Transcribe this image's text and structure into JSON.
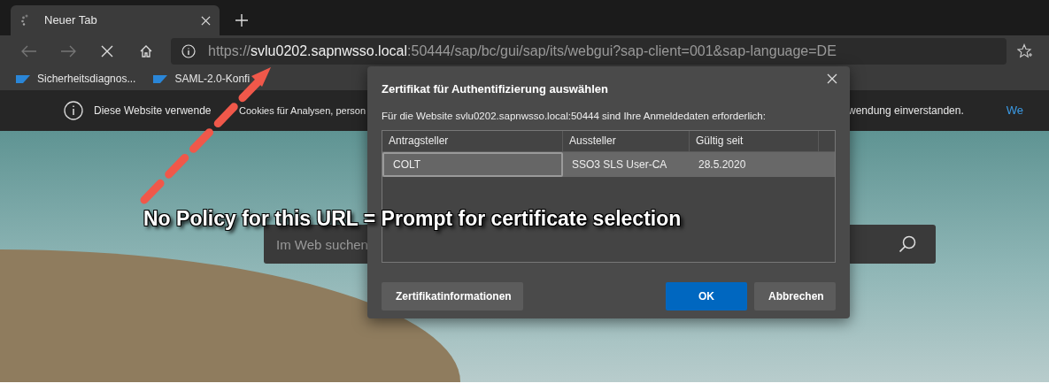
{
  "tab": {
    "title": "Neuer Tab",
    "loading": true
  },
  "address_bar": {
    "scheme": "https://",
    "host": "svlu0202.sapnwsso.local",
    "path": ":50444/sap/bc/gui/sap/its/webgui?sap-client=001&sap-language=DE"
  },
  "bookmarks": [
    {
      "label": "Sicherheitsdiagnos..."
    },
    {
      "label": "SAML-2.0-Konfi"
    }
  ],
  "cookie_banner": {
    "text_left": "Diese Website verwende",
    "text_middle": "Cookies für Analysen, person",
    "text_right": "wendung einverstanden.",
    "link": "We"
  },
  "search": {
    "placeholder": "Im Web suchen"
  },
  "dialog": {
    "title": "Zertifikat für Authentifizierung auswählen",
    "message": "Für die Website svlu0202.sapnwsso.local:50444 sind Ihre Anmeldedaten erforderlich:",
    "columns": [
      "Antragsteller",
      "Aussteller",
      "Gültig seit"
    ],
    "rows": [
      {
        "cells": [
          "COLT",
          "SSO3 SLS User-CA",
          "28.5.2020"
        ],
        "selected": true
      }
    ],
    "buttons": [
      {
        "label": "Zertifikatinformationen",
        "primary": false
      },
      {
        "label": "OK",
        "primary": true
      },
      {
        "label": "Abbrechen",
        "primary": false
      }
    ]
  },
  "annotation": {
    "text": "No Policy for this URL = Prompt for certificate selection"
  }
}
